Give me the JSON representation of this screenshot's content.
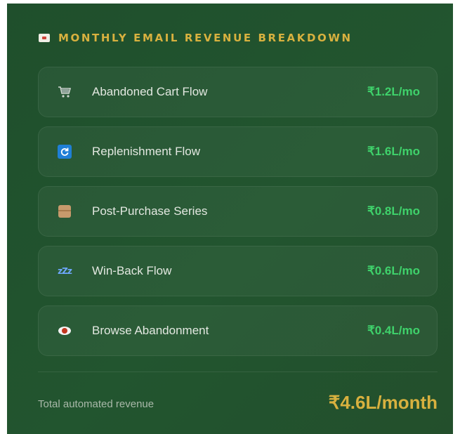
{
  "panel": {
    "heading": "MONTHLY EMAIL REVENUE BREAKDOWN",
    "heading_icon": "envelope-icon",
    "accent_gold": "#d8b13f",
    "value_green": "#3fd26b"
  },
  "flows": [
    {
      "label": "Abandoned Cart Flow",
      "value": "₹1.2L/mo",
      "icon": "shopping-cart-icon"
    },
    {
      "label": "Replenishment Flow",
      "value": "₹1.6L/mo",
      "icon": "refresh-icon"
    },
    {
      "label": "Post-Purchase Series",
      "value": "₹0.8L/mo",
      "icon": "package-icon"
    },
    {
      "label": "Win-Back Flow",
      "value": "₹0.6L/mo",
      "icon": "sleeping-zzz-icon"
    },
    {
      "label": "Browse Abandonment",
      "value": "₹0.4L/mo",
      "icon": "eye-icon"
    }
  ],
  "total": {
    "label": "Total automated revenue",
    "value": "₹4.6L/month"
  }
}
